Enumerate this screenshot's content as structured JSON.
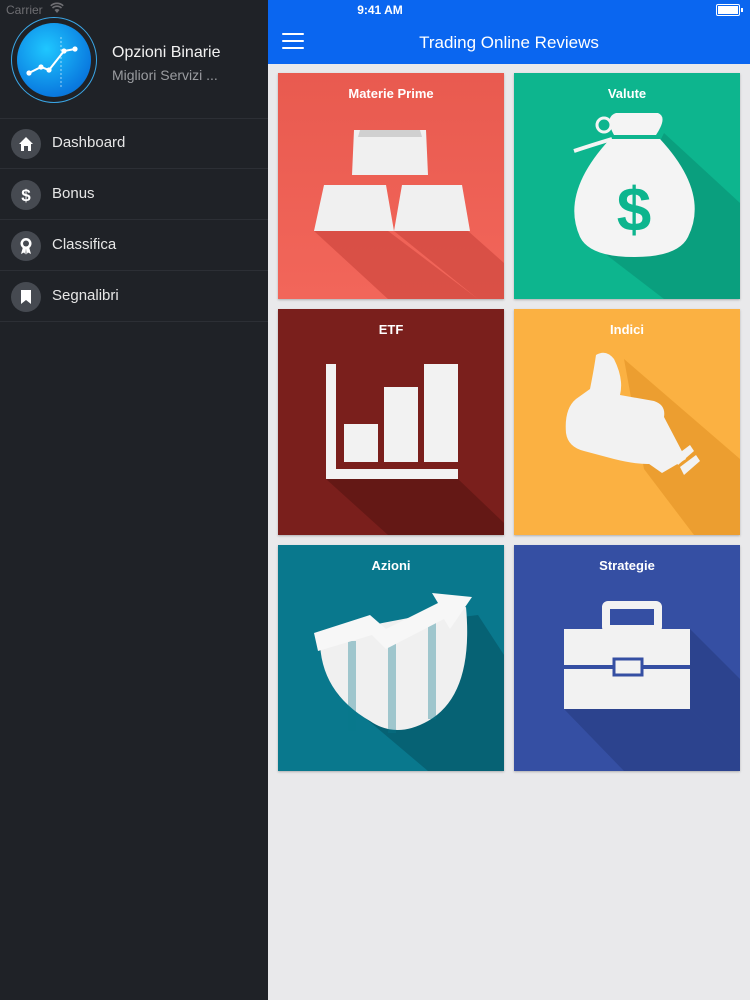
{
  "status_bar": {
    "carrier": "Carrier",
    "time": "9:41 AM"
  },
  "profile": {
    "title": "Opzioni Binarie",
    "subtitle": "Migliori Servizi ..."
  },
  "menu": [
    {
      "label": "Dashboard",
      "icon": "home-icon"
    },
    {
      "label": "Bonus",
      "icon": "dollar-icon"
    },
    {
      "label": "Classifica",
      "icon": "award-icon"
    },
    {
      "label": "Segnalibri",
      "icon": "bookmark-icon"
    }
  ],
  "header": {
    "title": "Trading Online Reviews"
  },
  "tiles": [
    {
      "label": "Materie Prime",
      "icon": "gold-bars-icon",
      "color": "#f2665a"
    },
    {
      "label": "Valute",
      "icon": "money-bag-icon",
      "color": "#0db58e"
    },
    {
      "label": "ETF",
      "icon": "bar-chart-icon",
      "color": "#7a1f1c"
    },
    {
      "label": "Indici",
      "icon": "thumbs-up-icon",
      "color": "#fbb142"
    },
    {
      "label": "Azioni",
      "icon": "stock-growth-icon",
      "color": "#09788d"
    },
    {
      "label": "Strategie",
      "icon": "briefcase-icon",
      "color": "#354fa3"
    }
  ],
  "colors": {
    "sidebar": "#1f2227",
    "header": "#0a66f0",
    "background": "#e9e9eb"
  }
}
